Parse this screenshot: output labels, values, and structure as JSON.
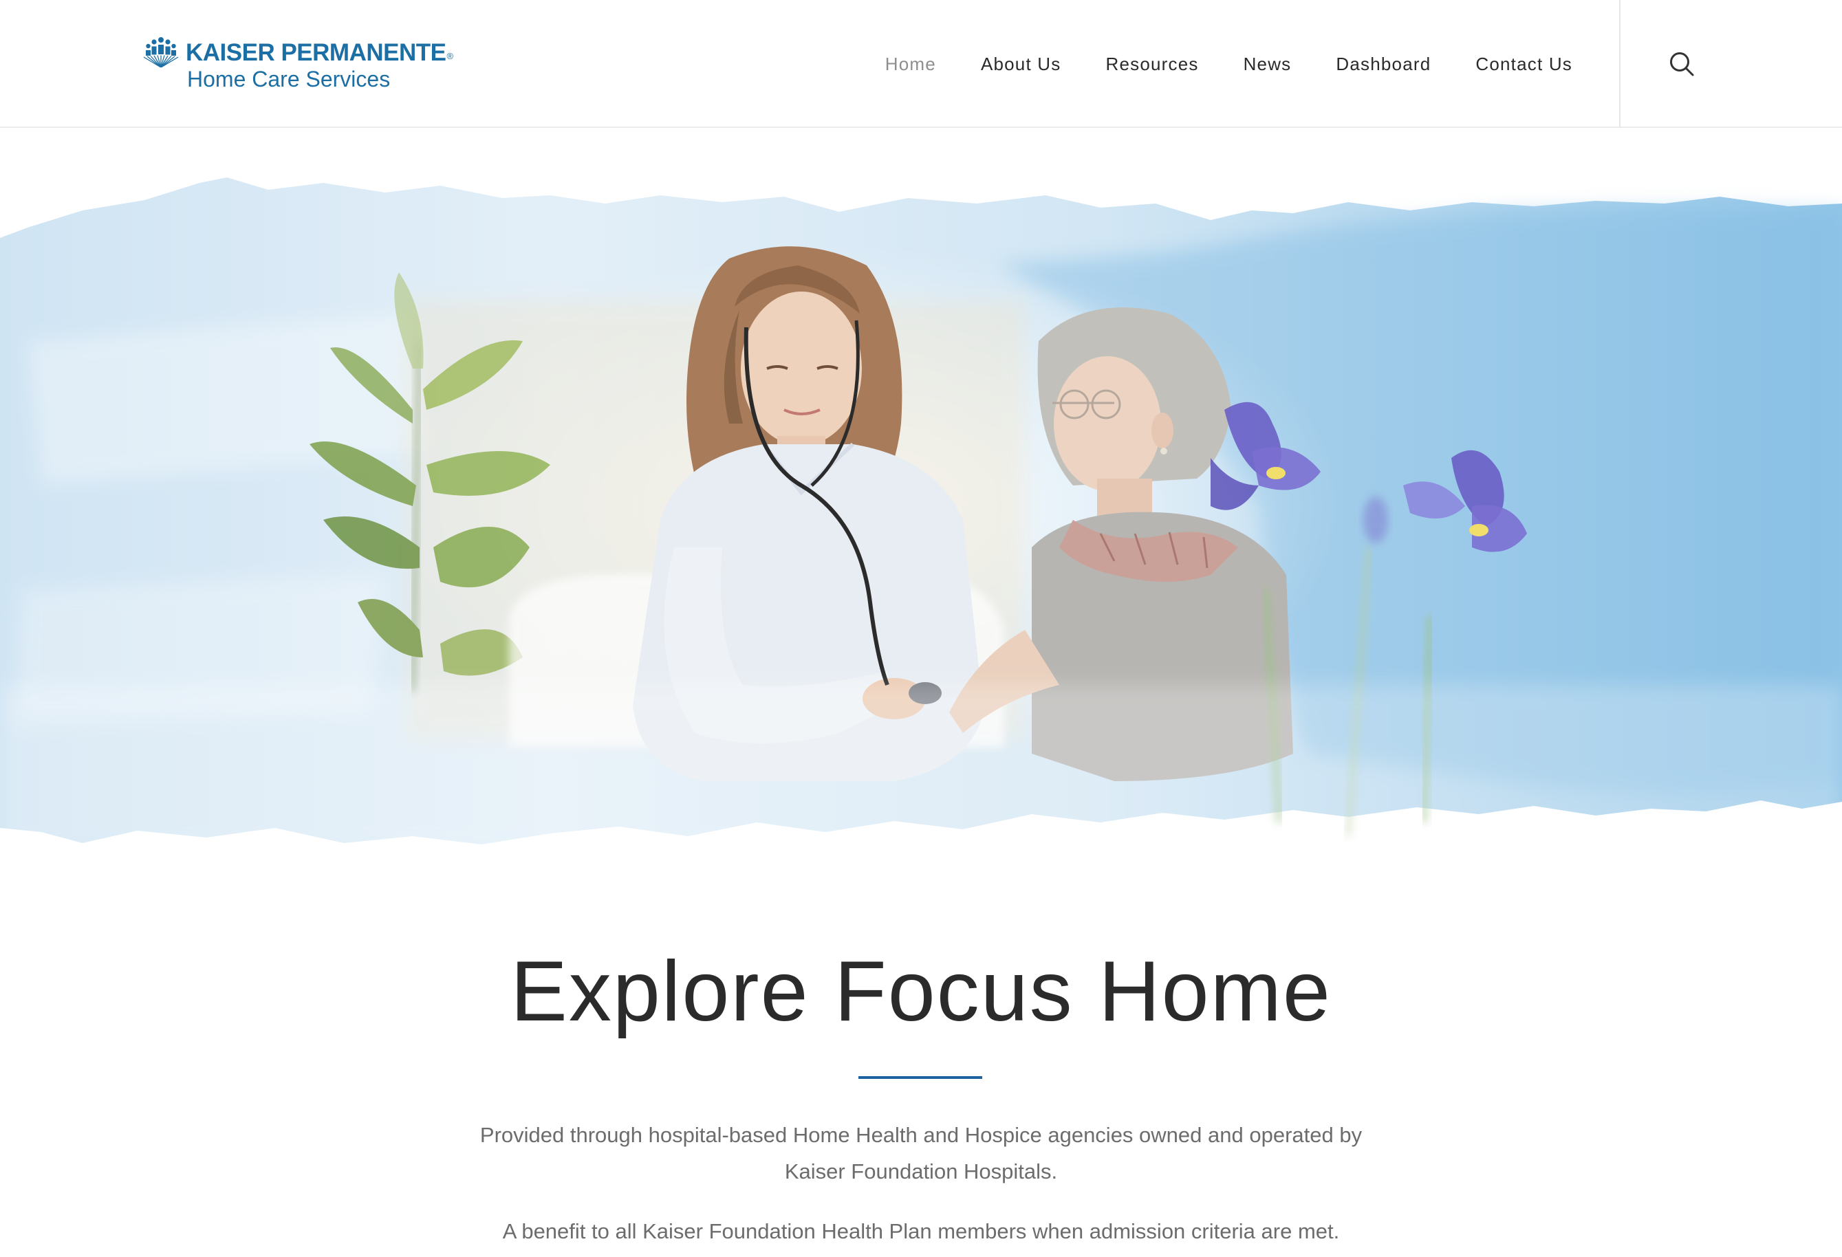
{
  "header": {
    "logo": {
      "name": "KAISER PERMANENTE",
      "registered": "®",
      "subtitle": "Home Care Services"
    },
    "nav": [
      {
        "label": "Home",
        "active": true
      },
      {
        "label": "About Us",
        "active": false
      },
      {
        "label": "Resources",
        "active": false
      },
      {
        "label": "News",
        "active": false
      },
      {
        "label": "Dashboard",
        "active": false
      },
      {
        "label": "Contact Us",
        "active": false
      }
    ],
    "search_icon": "search-icon"
  },
  "hero": {
    "image": "watercolor-hero-nurse-with-patient"
  },
  "main": {
    "title": "Explore Focus Home",
    "intro_line1": "Provided through hospital-based Home Health and Hospice agencies owned and operated by",
    "intro_line2": "Kaiser Foundation Hospitals.",
    "benefit": "A benefit to all Kaiser Foundation Health Plan members when admission criteria are met."
  },
  "colors": {
    "brand": "#1c6fa5",
    "rule": "#1f62a0",
    "body_text": "#6c6c6c",
    "nav_active": "#8e8e8e"
  }
}
